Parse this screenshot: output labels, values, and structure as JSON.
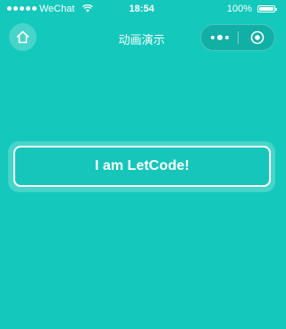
{
  "status_bar": {
    "carrier": "WeChat",
    "time": "18:54",
    "battery": "100%",
    "battery_level": 1.0,
    "signal_bars": 5
  },
  "nav": {
    "title": "动画演示",
    "home_icon": "home-icon",
    "more_icon": "more-icon",
    "close_icon": "close-circle-icon"
  },
  "main": {
    "button_label": "I am LetCode!"
  },
  "colors": {
    "background": "#14c8bc",
    "foreground": "#ffffff"
  }
}
